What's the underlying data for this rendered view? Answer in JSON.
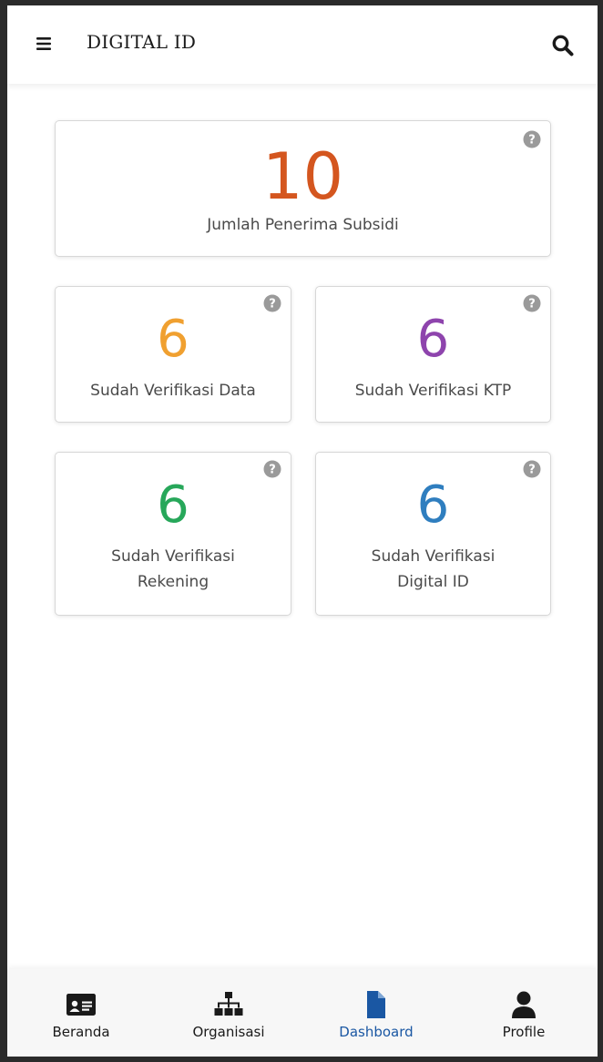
{
  "header": {
    "title": "DIGITAL ID",
    "menu_icon": "hamburger-menu-icon",
    "search_icon": "search-icon"
  },
  "stats": {
    "total": {
      "value": "10",
      "label": "Jumlah Penerima Subsidi",
      "color": "#d4561f"
    },
    "data": {
      "value": "6",
      "label": "Sudah Verifikasi Data",
      "color": "#f0a030"
    },
    "ktp": {
      "value": "6",
      "label": "Sudah Verifikasi KTP",
      "color": "#8e44ad"
    },
    "rekening": {
      "value": "6",
      "label_line1": "Sudah Verifikasi",
      "label_line2": "Rekening",
      "color": "#27a75a"
    },
    "digital_id": {
      "value": "6",
      "label_line1": "Sudah Verifikasi",
      "label_line2": "Digital ID",
      "color": "#2f7ebf"
    }
  },
  "help_icon": "question-circle-icon",
  "bottom_nav": {
    "items": [
      {
        "label": "Beranda",
        "icon": "id-card-icon",
        "active": false
      },
      {
        "label": "Organisasi",
        "icon": "org-chart-icon",
        "active": false
      },
      {
        "label": "Dashboard",
        "icon": "document-icon",
        "active": true
      },
      {
        "label": "Profile",
        "icon": "user-icon",
        "active": false
      }
    ],
    "active_color": "#1a57a3"
  }
}
